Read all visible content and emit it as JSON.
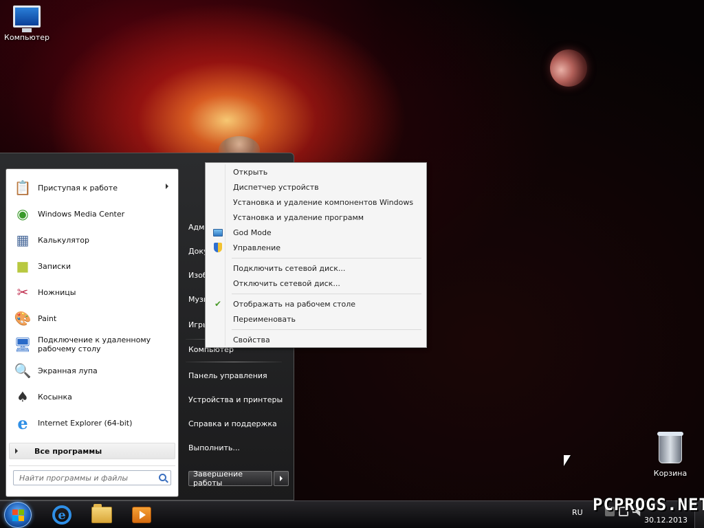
{
  "desktop": {
    "icons": [
      {
        "label": "Компьютер"
      },
      {
        "label": "Корзина"
      }
    ]
  },
  "start_menu": {
    "programs": [
      {
        "label": "Приступая к работе",
        "icon": "getting-started-icon",
        "has_submenu": true
      },
      {
        "label": "Windows Media Center",
        "icon": "media-center-icon"
      },
      {
        "label": "Калькулятор",
        "icon": "calculator-icon"
      },
      {
        "label": "Записки",
        "icon": "sticky-notes-icon"
      },
      {
        "label": "Ножницы",
        "icon": "snipping-tool-icon"
      },
      {
        "label": "Paint",
        "icon": "paint-icon"
      },
      {
        "label": "Подключение к удаленному рабочему столу",
        "icon": "remote-desktop-icon"
      },
      {
        "label": "Экранная лупа",
        "icon": "magnifier-icon"
      },
      {
        "label": "Косынка",
        "icon": "solitaire-icon"
      },
      {
        "label": "Internet Explorer (64-bit)",
        "icon": "internet-explorer-icon"
      }
    ],
    "all_programs": "Все программы",
    "search_placeholder": "Найти программы и файлы",
    "right_items": [
      {
        "label": "Адми"
      },
      {
        "label": "Доку"
      },
      {
        "label": "Изоб"
      },
      {
        "label": "Музы"
      },
      {
        "label": "Игры"
      },
      {
        "label": "Компьютер"
      },
      {
        "label": "Панель управления"
      },
      {
        "label": "Устройства и принтеры"
      },
      {
        "label": "Справка и поддержка"
      },
      {
        "label": "Выполнить..."
      }
    ],
    "shutdown_label": "Завершение работы"
  },
  "context_menu": {
    "items": [
      {
        "label": "Открыть"
      },
      {
        "label": "Диспетчер устройств"
      },
      {
        "label": "Установка и удаление компонентов Windows"
      },
      {
        "label": "Установка и удаление программ"
      },
      {
        "label": "God Mode",
        "icon": "god-mode-icon"
      },
      {
        "label": "Управление",
        "icon": "shield-icon"
      },
      {
        "label": "Подключить сетевой диск..."
      },
      {
        "label": "Отключить сетевой диск..."
      },
      {
        "label": "Отображать на рабочем столе",
        "checked": true
      },
      {
        "label": "Переименовать"
      },
      {
        "label": "Свойства"
      }
    ]
  },
  "taskbar": {
    "pinned": [
      "internet-explorer-icon",
      "explorer-folder-icon",
      "media-player-icon"
    ],
    "language": "RU",
    "date": "30.12.2013"
  },
  "watermark": "PCPROGS.NET"
}
